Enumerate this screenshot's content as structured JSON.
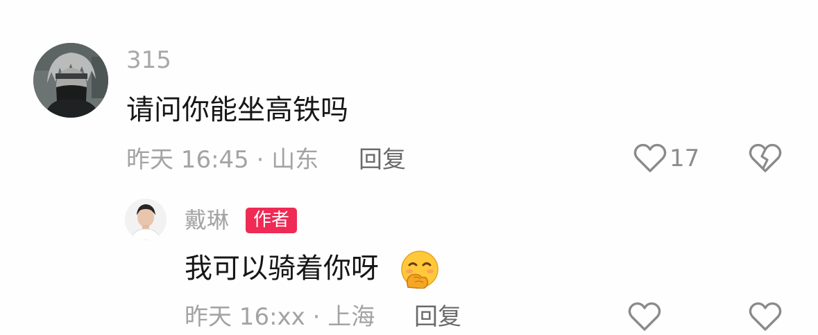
{
  "comment": {
    "username": "315",
    "text": "请问你能坐高铁吗",
    "meta": "昨天 16:45 · 山东",
    "reply_label": "回复",
    "like_count": "17",
    "avatar_icon": "anime-avatar",
    "like_icon": "heart-outline-icon",
    "dislike_icon": "broken-heart-icon"
  },
  "reply": {
    "username": "戴琳",
    "badge": "作者",
    "text": "我可以骑着你呀",
    "emoji_icon": "blush-hand-over-mouth-emoji",
    "avatar_icon": "person-avatar",
    "meta_partial": "昨天 16:xx · 上海",
    "reply_label": "回复",
    "like_icon": "heart-outline-icon",
    "dislike_icon": "broken-heart-icon"
  },
  "colors": {
    "badge_bg": "#ef2a55",
    "text_primary": "#161616",
    "text_secondary": "#a3a3a3",
    "reply_text": "#6a6a6a"
  }
}
